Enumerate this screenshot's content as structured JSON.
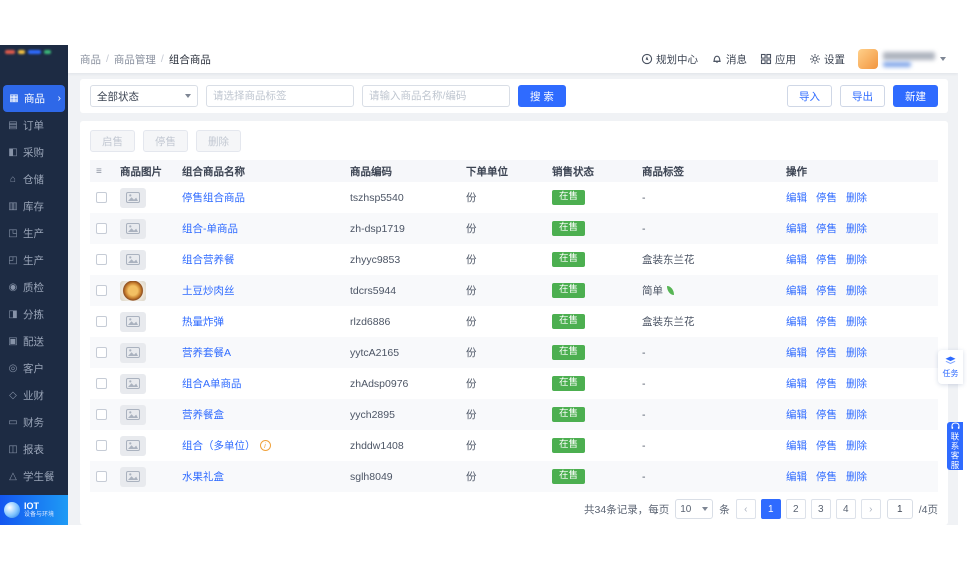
{
  "theme": {
    "accent": "#2f6bff",
    "sidebar_bg": "#1d2b43",
    "success": "#4caf50",
    "warning": "#f0a23c"
  },
  "icons": {
    "goods-icon": "▦",
    "orders-icon": "▤",
    "purchase-icon": "◧",
    "warehouse-icon": "⌂",
    "inventory-icon": "▥",
    "production-icon": "◳",
    "production2-icon": "◰",
    "quality-icon": "◉",
    "sorting-icon": "◨",
    "delivery-icon": "▣",
    "customer-icon": "◎",
    "business-finance-icon": "◇",
    "finance-icon": "▭",
    "reports-icon": "◫",
    "student-meal-icon": "△",
    "table-settings-icon": "≡",
    "chevron-left-icon": "‹",
    "chevron-right-icon": "›"
  },
  "sidebar": {
    "items": [
      {
        "key": "goods",
        "label": "商品",
        "icon": "goods-icon",
        "active": true
      },
      {
        "key": "orders",
        "label": "订单",
        "icon": "orders-icon"
      },
      {
        "key": "purchase",
        "label": "采购",
        "icon": "purchase-icon"
      },
      {
        "key": "warehouse",
        "label": "仓储",
        "icon": "warehouse-icon"
      },
      {
        "key": "inventory",
        "label": "库存",
        "icon": "inventory-icon"
      },
      {
        "key": "production",
        "label": "生产",
        "icon": "production-icon"
      },
      {
        "key": "production-2",
        "label": "生产",
        "icon": "production2-icon"
      },
      {
        "key": "quality",
        "label": "质检",
        "icon": "quality-icon"
      },
      {
        "key": "sorting",
        "label": "分拣",
        "icon": "sorting-icon"
      },
      {
        "key": "delivery",
        "label": "配送",
        "icon": "delivery-icon"
      },
      {
        "key": "customer",
        "label": "客户",
        "icon": "customer-icon"
      },
      {
        "key": "business-finance",
        "label": "业财",
        "icon": "business-finance-icon"
      },
      {
        "key": "finance",
        "label": "财务",
        "icon": "finance-icon"
      },
      {
        "key": "reports",
        "label": "报表",
        "icon": "reports-icon"
      },
      {
        "key": "student-meal",
        "label": "学生餐",
        "icon": "student-meal-icon"
      }
    ],
    "bottom": {
      "title": "IOT",
      "subtitle": "设备与环境"
    }
  },
  "header": {
    "breadcrumb": [
      "商品",
      "商品管理",
      "组合商品"
    ],
    "actions": [
      {
        "key": "planning-center",
        "label": "规划中心",
        "icon": "compass-icon"
      },
      {
        "key": "messages",
        "label": "消息",
        "icon": "bell-icon"
      },
      {
        "key": "apps",
        "label": "应用",
        "icon": "apps-icon"
      },
      {
        "key": "settings",
        "label": "设置",
        "icon": "gear-icon"
      }
    ]
  },
  "filters": {
    "status_select": "全部状态",
    "tag_placeholder": "请选择商品标签",
    "keyword_placeholder": "请输入商品名称/编码",
    "search_label": "搜 索",
    "import_label": "导入",
    "export_label": "导出",
    "create_label": "新建"
  },
  "toolbar": {
    "enable_label": "启售",
    "disable_label": "停售",
    "delete_label": "删除"
  },
  "table": {
    "columns": [
      "商品图片",
      "组合商品名称",
      "商品编码",
      "下单单位",
      "销售状态",
      "商品标签",
      "操作"
    ],
    "actions": [
      "编辑",
      "停售",
      "删除"
    ],
    "rows": [
      {
        "name": "停售组合商品",
        "code": "tszhsp5540",
        "unit": "份",
        "status": "在售",
        "tag": "-",
        "image": "placeholder"
      },
      {
        "name": "组合-单商品",
        "code": "zh-dsp1719",
        "unit": "份",
        "status": "在售",
        "tag": "-",
        "image": "placeholder"
      },
      {
        "name": "组合营养餐",
        "code": "zhyyc9853",
        "unit": "份",
        "status": "在售",
        "tag": "盒装东兰花",
        "image": "placeholder"
      },
      {
        "name": "土豆炒肉丝",
        "code": "tdcrs5944",
        "unit": "份",
        "status": "在售",
        "tag": "简单",
        "tag_icon": "leaf-icon",
        "image": "food-photo"
      },
      {
        "name": "热量炸弹",
        "code": "rlzd6886",
        "unit": "份",
        "status": "在售",
        "tag": "盒装东兰花",
        "image": "placeholder"
      },
      {
        "name": "营养套餐A",
        "code": "yytcA2165",
        "unit": "份",
        "status": "在售",
        "tag": "-",
        "image": "placeholder"
      },
      {
        "name": "组合A单商品",
        "code": "zhAdsp0976",
        "unit": "份",
        "status": "在售",
        "tag": "-",
        "image": "placeholder"
      },
      {
        "name": "营养餐盒",
        "code": "yych2895",
        "unit": "份",
        "status": "在售",
        "tag": "-",
        "image": "placeholder"
      },
      {
        "name": "组合（多单位）",
        "code": "zhddw1408",
        "unit": "份",
        "status": "在售",
        "tag": "-",
        "image": "placeholder",
        "info_icon": true
      },
      {
        "name": "水果礼盒",
        "code": "sglh8049",
        "unit": "份",
        "status": "在售",
        "tag": "-",
        "image": "placeholder"
      }
    ]
  },
  "pagination": {
    "total_text": "共34条记录，每页",
    "page_size": "10",
    "unit_text": "条",
    "pages": [
      "1",
      "2",
      "3",
      "4"
    ],
    "current_page": "1",
    "jump_value": "1",
    "total_pages_text": "/4页"
  },
  "floating": {
    "task_label": "任务",
    "service_label": "联系客服"
  }
}
